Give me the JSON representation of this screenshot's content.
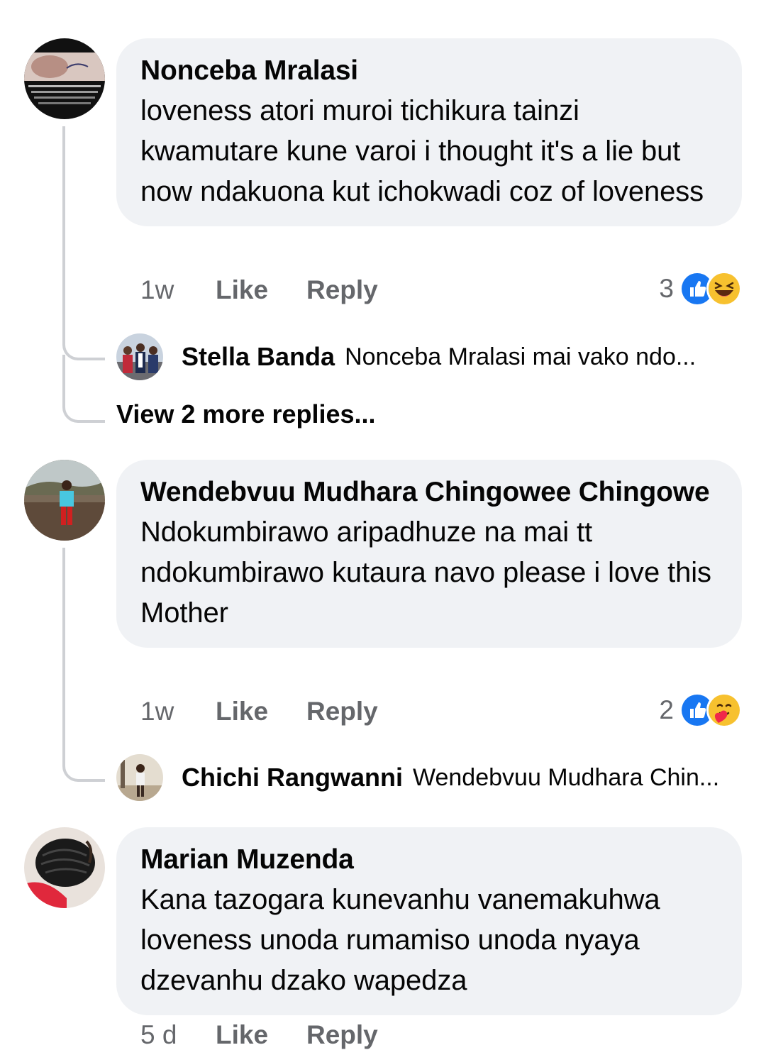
{
  "comments": [
    {
      "author": "Nonceba Mralasi",
      "text": "loveness atori muroi tichikura tainzi kwamutare kune varoi i thought it's a lie but now ndakuona kut ichokwadi coz of loveness",
      "time": "1w",
      "like_label": "Like",
      "reply_label": "Reply",
      "reaction_count": "3",
      "reactions": [
        "like-icon",
        "haha-icon"
      ],
      "reply_preview": {
        "author": "Stella Banda",
        "text": "Nonceba Mralasi mai vako ndo..."
      },
      "more_replies": "View 2 more replies..."
    },
    {
      "author": "Wendebvuu Mudhara Chingowee Chingowe",
      "text": "Ndokumbirawo aripadhuze na mai tt ndokumbirawo kutaura navo please i love this Mother",
      "time": "1w",
      "like_label": "Like",
      "reply_label": "Reply",
      "reaction_count": "2",
      "reactions": [
        "like-icon",
        "care-icon"
      ],
      "reply_preview": {
        "author": "Chichi Rangwanni",
        "text": "Wendebvuu Mudhara Chin..."
      }
    },
    {
      "author": "Marian Muzenda",
      "text": "Kana tazogara kunevanhu vanemakuhwa loveness unoda rumamiso unoda nyaya dzevanhu dzako wapedza",
      "time": "5 d",
      "like_label": "Like",
      "reply_label": "Reply"
    }
  ],
  "colors": {
    "bubble": "#f0f2f5",
    "meta_text": "#65676b",
    "like_blue": "#1877f2",
    "thread_line": "#ced0d4"
  }
}
